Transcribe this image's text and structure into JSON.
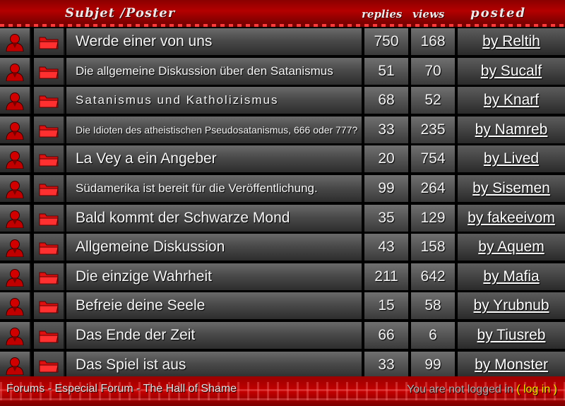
{
  "header": {
    "subject_poster": "Subjet /Poster",
    "replies": "replies",
    "views": "views",
    "posted": "posted"
  },
  "threads": [
    {
      "subject": "Werde einer von uns",
      "replies": "750",
      "views": "168",
      "poster": "by Reltih"
    },
    {
      "subject": "Die allgemeine Diskussion über den Satanismus",
      "replies": "51",
      "views": "70",
      "poster": "by Sucalf"
    },
    {
      "subject": "Satanismus und Katholizismus",
      "replies": "68",
      "views": "52",
      "poster": "by Knarf"
    },
    {
      "subject": "Die Idioten des atheistischen Pseudosatanismus, 666 oder 777?",
      "replies": "33",
      "views": "235",
      "poster": "by Namreb"
    },
    {
      "subject": "La Vey a  ein Angeber",
      "replies": "20",
      "views": "754",
      "poster": "by Lived"
    },
    {
      "subject": "Südamerika ist bereit für die Veröffentlichung.",
      "replies": "99",
      "views": "264",
      "poster": "by Sisemen"
    },
    {
      "subject": "Bald kommt der Schwarze Mond",
      "replies": "35",
      "views": "129",
      "poster": "by fakeeivom"
    },
    {
      "subject": "Allgemeine Diskussion",
      "replies": "43",
      "views": "158",
      "poster": "by Aquem"
    },
    {
      "subject": "Die einzige Wahrheit",
      "replies": "211",
      "views": "642",
      "poster": "by Mafia"
    },
    {
      "subject": "Befreie deine Seele",
      "replies": "15",
      "views": "58",
      "poster": "by Yrubnub"
    },
    {
      "subject": "Das Ende der Zeit",
      "replies": "66",
      "views": "6",
      "poster": "by Tiusreb"
    },
    {
      "subject": "Das Spiel ist aus",
      "replies": "33",
      "views": "99",
      "poster": "by Monster"
    }
  ],
  "icons": {
    "row_avatar": "user-icon",
    "row_folder": "folder-icon"
  },
  "footer": {
    "breadcrumb": [
      "Forums",
      "Especial Forum",
      "The Hall of Shame"
    ],
    "separator": " - ",
    "status_text": "You are not logged in",
    "paren_open": "(",
    "login_link": "log in",
    "paren_close": ")"
  },
  "colors": {
    "header_red": "#b40000",
    "footer_red": "#c40000",
    "login_link": "#ffe400",
    "row_gray": "#4a4a4a"
  }
}
